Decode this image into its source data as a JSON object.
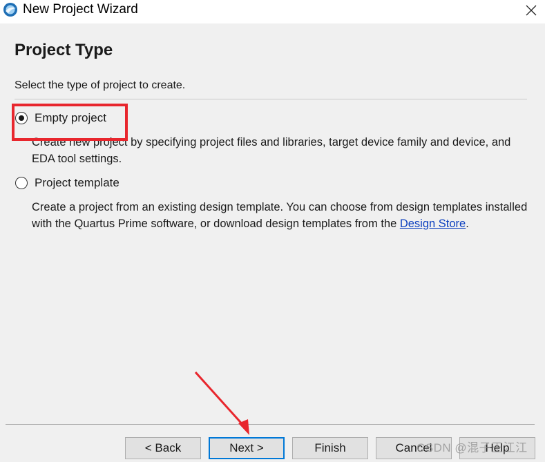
{
  "window": {
    "title": "New Project Wizard"
  },
  "page": {
    "heading": "Project Type",
    "subtitle": "Select the type of project to create."
  },
  "options": [
    {
      "label": "Empty project",
      "selected": true,
      "description": "Create new project by specifying project files and libraries, target device family and device, and EDA tool settings."
    },
    {
      "label": "Project template",
      "selected": false,
      "description_prefix": "Create a project from an existing design template. You can choose from design templates installed with the Quartus Prime software, or download design templates from the ",
      "link_text": "Design Store",
      "description_suffix": "."
    }
  ],
  "buttons": {
    "back": "< Back",
    "next": "Next >",
    "finish": "Finish",
    "cancel": "Cancel",
    "help": "Help"
  },
  "watermark": "CSDN @混子王江江",
  "colors": {
    "annotation_red": "#e8262d",
    "link_blue": "#0b3fbf",
    "focus_blue": "#0078d7"
  },
  "icons": [
    "quartus-app-icon",
    "close-icon"
  ]
}
